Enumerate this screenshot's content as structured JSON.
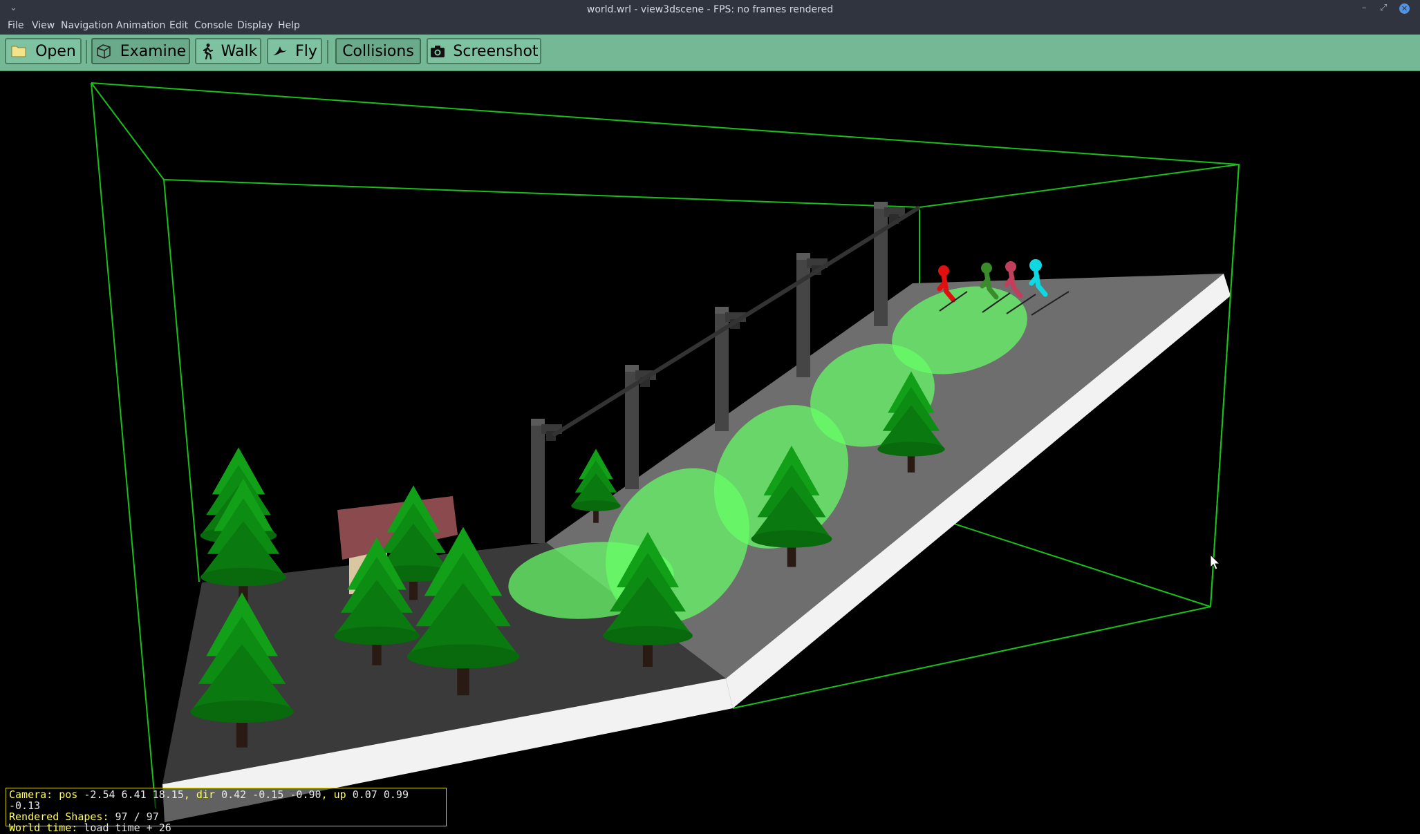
{
  "window": {
    "title": "world.wrl - view3dscene - FPS: no frames rendered",
    "sys_menu": "⌄",
    "minimize": "–",
    "maximize": "⤢",
    "close": "✕"
  },
  "menu": [
    "File",
    "View",
    "Navigation",
    "Animation",
    "Edit",
    "Console",
    "Display",
    "Help"
  ],
  "toolbar": {
    "open": "Open",
    "examine": "Examine",
    "walk": "Walk",
    "fly": "Fly",
    "collisions": "Collisions",
    "screenshot": "Screenshot"
  },
  "hud": {
    "camera_label": "Camera:",
    "pos_label": "pos",
    "pos_value": "-2.54 6.41 18.15",
    "dir_label": ", dir",
    "dir_value": "0.42 -0.15 -0.90",
    "up_label": ", up",
    "up_value": "0.07 0.99 -0.13",
    "shapes_label": "Rendered Shapes:",
    "shapes_value": "97 / 97",
    "time_label": "World time:",
    "time_value": "load time + 26"
  },
  "colors": {
    "toolbar_bg": "#74b896",
    "bbox": "#18c018",
    "ground": "#3a3a3a",
    "slope": "#6a6a6a",
    "slope_edge": "#f2f2f2",
    "tree": "#0b8a12",
    "spot": "#66ff66",
    "skier_colors": [
      "#e01010",
      "#3a8c2a",
      "#c0405c",
      "#10d8e0"
    ]
  }
}
